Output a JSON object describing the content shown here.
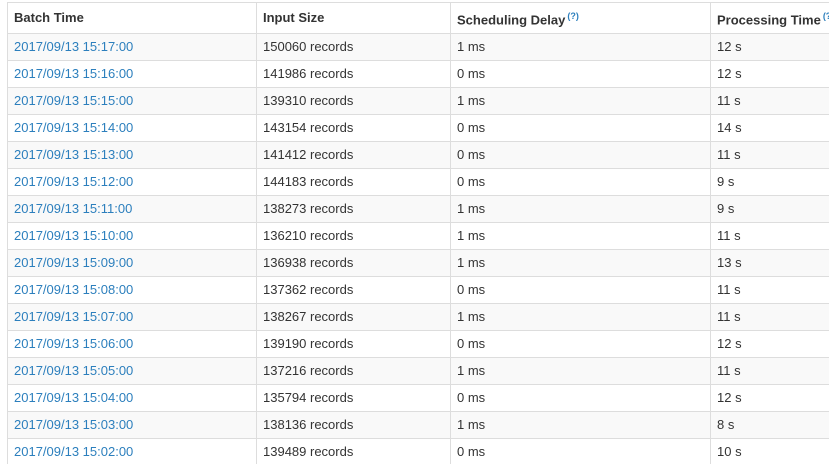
{
  "table": {
    "headers": {
      "batch_time": "Batch Time",
      "input_size": "Input Size",
      "scheduling_delay": "Scheduling Delay",
      "scheduling_delay_help": "(?)",
      "processing_time": "Processing Time",
      "processing_time_help": "(?)"
    },
    "rows": [
      {
        "batch_time": "2017/09/13 15:17:00",
        "input_size": "150060 records",
        "scheduling_delay": "1 ms",
        "processing_time": "12 s"
      },
      {
        "batch_time": "2017/09/13 15:16:00",
        "input_size": "141986 records",
        "scheduling_delay": "0 ms",
        "processing_time": "12 s"
      },
      {
        "batch_time": "2017/09/13 15:15:00",
        "input_size": "139310 records",
        "scheduling_delay": "1 ms",
        "processing_time": "11 s"
      },
      {
        "batch_time": "2017/09/13 15:14:00",
        "input_size": "143154 records",
        "scheduling_delay": "0 ms",
        "processing_time": "14 s"
      },
      {
        "batch_time": "2017/09/13 15:13:00",
        "input_size": "141412 records",
        "scheduling_delay": "0 ms",
        "processing_time": "11 s"
      },
      {
        "batch_time": "2017/09/13 15:12:00",
        "input_size": "144183 records",
        "scheduling_delay": "0 ms",
        "processing_time": "9 s"
      },
      {
        "batch_time": "2017/09/13 15:11:00",
        "input_size": "138273 records",
        "scheduling_delay": "1 ms",
        "processing_time": "9 s"
      },
      {
        "batch_time": "2017/09/13 15:10:00",
        "input_size": "136210 records",
        "scheduling_delay": "1 ms",
        "processing_time": "11 s"
      },
      {
        "batch_time": "2017/09/13 15:09:00",
        "input_size": "136938 records",
        "scheduling_delay": "1 ms",
        "processing_time": "13 s"
      },
      {
        "batch_time": "2017/09/13 15:08:00",
        "input_size": "137362 records",
        "scheduling_delay": "0 ms",
        "processing_time": "11 s"
      },
      {
        "batch_time": "2017/09/13 15:07:00",
        "input_size": "138267 records",
        "scheduling_delay": "1 ms",
        "processing_time": "11 s"
      },
      {
        "batch_time": "2017/09/13 15:06:00",
        "input_size": "139190 records",
        "scheduling_delay": "0 ms",
        "processing_time": "12 s"
      },
      {
        "batch_time": "2017/09/13 15:05:00",
        "input_size": "137216 records",
        "scheduling_delay": "1 ms",
        "processing_time": "11 s"
      },
      {
        "batch_time": "2017/09/13 15:04:00",
        "input_size": "135794 records",
        "scheduling_delay": "0 ms",
        "processing_time": "12 s"
      },
      {
        "batch_time": "2017/09/13 15:03:00",
        "input_size": "138136 records",
        "scheduling_delay": "1 ms",
        "processing_time": "8 s"
      },
      {
        "batch_time": "2017/09/13 15:02:00",
        "input_size": "139489 records",
        "scheduling_delay": "0 ms",
        "processing_time": "10 s"
      }
    ]
  },
  "colors": {
    "link": "#2c7fbd",
    "border": "#dddddd",
    "stripe": "#f9f9f9",
    "text": "#333333"
  }
}
